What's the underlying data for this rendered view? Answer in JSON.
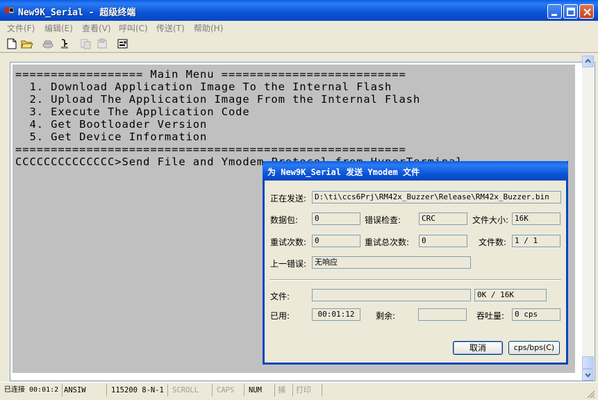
{
  "window": {
    "title": "New9K_Serial - 超级终端",
    "colors": {
      "titlebar": "#0B55D8",
      "terminal_bg": "#C0C0C0",
      "dialog_border": "#0845C0"
    }
  },
  "menu": {
    "items": [
      {
        "label": "文件(F)"
      },
      {
        "label": "编辑(E)"
      },
      {
        "label": "查看(V)"
      },
      {
        "label": "呼叫(C)"
      },
      {
        "label": "传送(T)"
      },
      {
        "label": "帮助(H)"
      }
    ]
  },
  "toolbar": {
    "icons": [
      "new-file-icon",
      "open-folder-icon",
      "phone-icon",
      "disconnect-icon",
      "send-icon",
      "receive-icon",
      "properties-icon"
    ]
  },
  "terminal": {
    "lines": [
      "================== Main Menu ==========================",
      "  1. Download Application Image To the Internal Flash",
      "  2. Upload The Application Image From the Internal Flash",
      "  3. Execute The Application Code",
      "  4. Get Bootloader Version",
      "  5. Get Device Information",
      "=======================================================",
      "CCCCCCCCCCCCCC>Send File and Ymodem Protocol from HyperTerminal"
    ]
  },
  "dialog": {
    "title": "为 New9K_Serial 发送 Ymodem 文件",
    "sending_label": "正在发送:",
    "sending_value": "D:\\ti\\ccs6Prj\\RM42x_Buzzer\\Release\\RM42x_Buzzer.bin",
    "packet_label": "数据包:",
    "packet_value": "0",
    "error_check_label": "错误检查:",
    "error_check_value": "CRC",
    "file_size_label": "文件大小:",
    "file_size_value": "16K",
    "retries_label": "重试次数:",
    "retries_value": "0",
    "total_retries_label": "重试总次数:",
    "total_retries_value": "0",
    "files_label": "文件数:",
    "files_value": "1 / 1",
    "last_error_label": "上一错误:",
    "last_error_value": "无响应",
    "file_label": "文件:",
    "file_progress": 0,
    "file_progress_text": "0K / 16K",
    "elapsed_label": "已用:",
    "elapsed_value": "00:01:12",
    "remaining_label": "剩余:",
    "remaining_value": "",
    "throughput_label": "吞吐量:",
    "throughput_value": "0 cps",
    "cancel_label": "取消",
    "cps_bps_label": "cps/bps(C)"
  },
  "status": {
    "connected": "已连接 00:01:2",
    "emulation": "ANSIW",
    "settings": "115200 8-N-1",
    "scroll": "SCROLL",
    "caps": "CAPS",
    "num": "NUM",
    "capture": "捕",
    "print": "打印"
  }
}
